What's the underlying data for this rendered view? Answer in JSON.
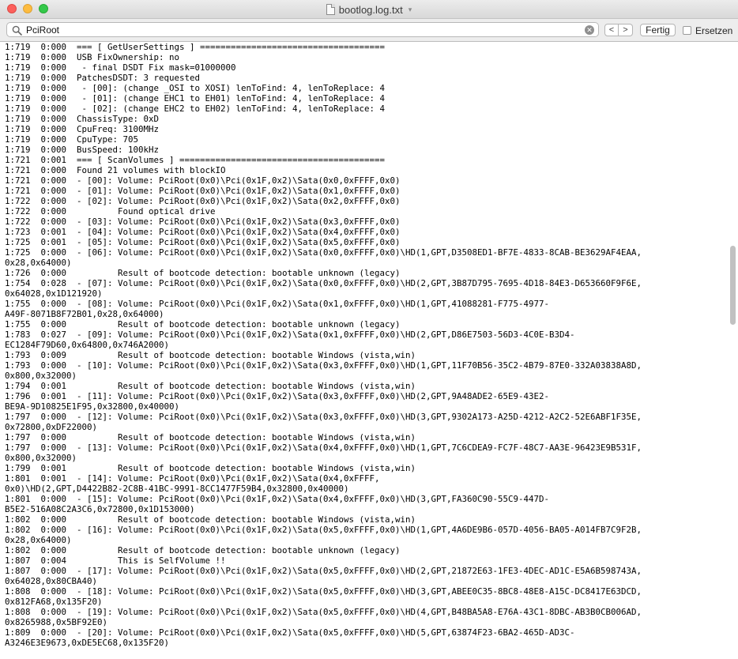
{
  "window": {
    "title": "bootlog.log.txt"
  },
  "findbar": {
    "search_value": "PciRoot",
    "prev_label": "<",
    "next_label": ">",
    "done_label": "Fertig",
    "replace_label": "Ersetzen",
    "replace_checked": false
  },
  "log_lines": [
    "1:719  0:000  === [ GetUserSettings ] ====================================",
    "1:719  0:000  USB FixOwnership: no",
    "1:719  0:000   - final DSDT Fix mask=01000000",
    "1:719  0:000  PatchesDSDT: 3 requested",
    "1:719  0:000   - [00]: (change _OSI to XOSI) lenToFind: 4, lenToReplace: 4",
    "1:719  0:000   - [01]: (change EHC1 to EH01) lenToFind: 4, lenToReplace: 4",
    "1:719  0:000   - [02]: (change EHC2 to EH02) lenToFind: 4, lenToReplace: 4",
    "1:719  0:000  ChassisType: 0xD",
    "1:719  0:000  CpuFreq: 3100MHz",
    "1:719  0:000  CpuType: 705",
    "1:719  0:000  BusSpeed: 100kHz",
    "1:721  0:001  === [ ScanVolumes ] ========================================",
    "1:721  0:000  Found 21 volumes with blockIO",
    "1:721  0:000  - [00]: Volume: PciRoot(0x0)\\Pci(0x1F,0x2)\\Sata(0x0,0xFFFF,0x0)",
    "1:721  0:000  - [01]: Volume: PciRoot(0x0)\\Pci(0x1F,0x2)\\Sata(0x1,0xFFFF,0x0)",
    "1:722  0:000  - [02]: Volume: PciRoot(0x0)\\Pci(0x1F,0x2)\\Sata(0x2,0xFFFF,0x0)",
    "1:722  0:000          Found optical drive",
    "1:722  0:000  - [03]: Volume: PciRoot(0x0)\\Pci(0x1F,0x2)\\Sata(0x3,0xFFFF,0x0)",
    "1:723  0:001  - [04]: Volume: PciRoot(0x0)\\Pci(0x1F,0x2)\\Sata(0x4,0xFFFF,0x0)",
    "1:725  0:001  - [05]: Volume: PciRoot(0x0)\\Pci(0x1F,0x2)\\Sata(0x5,0xFFFF,0x0)",
    "1:725  0:000  - [06]: Volume: PciRoot(0x0)\\Pci(0x1F,0x2)\\Sata(0x0,0xFFFF,0x0)\\HD(1,GPT,D3508ED1-BF7E-4833-8CAB-BE3629AF4EAA,",
    "0x28,0x64000)",
    "1:726  0:000          Result of bootcode detection: bootable unknown (legacy)",
    "1:754  0:028  - [07]: Volume: PciRoot(0x0)\\Pci(0x1F,0x2)\\Sata(0x0,0xFFFF,0x0)\\HD(2,GPT,3B87D795-7695-4D18-84E3-D653660F9F6E,",
    "0x64028,0x1D121920)",
    "1:755  0:000  - [08]: Volume: PciRoot(0x0)\\Pci(0x1F,0x2)\\Sata(0x1,0xFFFF,0x0)\\HD(1,GPT,41088281-F775-4977-",
    "A49F-8071B8F72B01,0x28,0x64000)",
    "1:755  0:000          Result of bootcode detection: bootable unknown (legacy)",
    "1:783  0:027  - [09]: Volume: PciRoot(0x0)\\Pci(0x1F,0x2)\\Sata(0x1,0xFFFF,0x0)\\HD(2,GPT,D86E7503-56D3-4C0E-B3D4-",
    "EC1284F79D60,0x64800,0x746A2000)",
    "1:793  0:009          Result of bootcode detection: bootable Windows (vista,win)",
    "1:793  0:000  - [10]: Volume: PciRoot(0x0)\\Pci(0x1F,0x2)\\Sata(0x3,0xFFFF,0x0)\\HD(1,GPT,11F70B56-35C2-4B79-87E0-332A03838A8D,",
    "0x800,0x32000)",
    "1:794  0:001          Result of bootcode detection: bootable Windows (vista,win)",
    "1:796  0:001  - [11]: Volume: PciRoot(0x0)\\Pci(0x1F,0x2)\\Sata(0x3,0xFFFF,0x0)\\HD(2,GPT,9A48ADE2-65E9-43E2-",
    "BE9A-9D10825E1F95,0x32800,0x40000)",
    "1:797  0:000  - [12]: Volume: PciRoot(0x0)\\Pci(0x1F,0x2)\\Sata(0x3,0xFFFF,0x0)\\HD(3,GPT,9302A173-A25D-4212-A2C2-52E6ABF1F35E,",
    "0x72800,0xDF22000)",
    "1:797  0:000          Result of bootcode detection: bootable Windows (vista,win)",
    "1:797  0:000  - [13]: Volume: PciRoot(0x0)\\Pci(0x1F,0x2)\\Sata(0x4,0xFFFF,0x0)\\HD(1,GPT,7C6CDEA9-FC7F-48C7-AA3E-96423E9B531F,",
    "0x800,0x32000)",
    "1:799  0:001          Result of bootcode detection: bootable Windows (vista,win)",
    "1:801  0:001  - [14]: Volume: PciRoot(0x0)\\Pci(0x1F,0x2)\\Sata(0x4,0xFFFF,",
    "0x0)\\HD(2,GPT,D4422B82-2C8B-41BC-9991-8CC1477F59B4,0x32800,0x40000)",
    "1:801  0:000  - [15]: Volume: PciRoot(0x0)\\Pci(0x1F,0x2)\\Sata(0x4,0xFFFF,0x0)\\HD(3,GPT,FA360C90-55C9-447D-",
    "B5E2-516A08C2A3C6,0x72800,0x1D153000)",
    "1:802  0:000          Result of bootcode detection: bootable Windows (vista,win)",
    "1:802  0:000  - [16]: Volume: PciRoot(0x0)\\Pci(0x1F,0x2)\\Sata(0x5,0xFFFF,0x0)\\HD(1,GPT,4A6DE9B6-057D-4056-BA05-A014FB7C9F2B,",
    "0x28,0x64000)",
    "1:802  0:000          Result of bootcode detection: bootable unknown (legacy)",
    "1:807  0:004          This is SelfVolume !!",
    "1:807  0:000  - [17]: Volume: PciRoot(0x0)\\Pci(0x1F,0x2)\\Sata(0x5,0xFFFF,0x0)\\HD(2,GPT,21872E63-1FE3-4DEC-AD1C-E5A6B598743A,",
    "0x64028,0x80CBA40)",
    "1:808  0:000  - [18]: Volume: PciRoot(0x0)\\Pci(0x1F,0x2)\\Sata(0x5,0xFFFF,0x0)\\HD(3,GPT,ABEE0C35-8BC8-48E8-A15C-DC8417E63DCD,",
    "0x812FA68,0x135F20)",
    "1:808  0:000  - [19]: Volume: PciRoot(0x0)\\Pci(0x1F,0x2)\\Sata(0x5,0xFFFF,0x0)\\HD(4,GPT,B48BA5A8-E76A-43C1-8DBC-AB3B0CB006AD,",
    "0x8265988,0x5BF92E0)",
    "1:809  0:000  - [20]: Volume: PciRoot(0x0)\\Pci(0x1F,0x2)\\Sata(0x5,0xFFFF,0x0)\\HD(5,GPT,63874F23-6BA2-465D-AD3C-",
    "A3246E3E9673,0xDE5EC68,0x135F20)"
  ]
}
